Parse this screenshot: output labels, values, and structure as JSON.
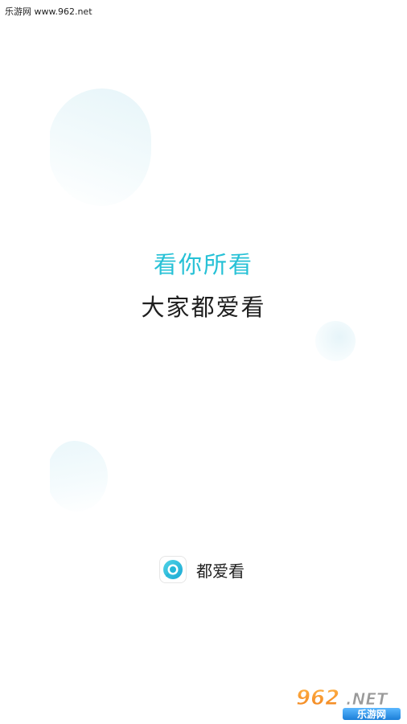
{
  "watermark_top": "乐游网 www.962.net",
  "slogan": {
    "line1": "看你所看",
    "line2": "大家都爱看"
  },
  "brand": {
    "icon": "eye-logo-icon",
    "name": "都爱看"
  },
  "watermark_bottom": {
    "icon": "962-net-logo",
    "number": "962",
    "suffix": ".NET",
    "caption": "乐游网"
  },
  "colors": {
    "accent": "#26c1d6",
    "text": "#1f1f1f",
    "background": "#ffffff"
  }
}
